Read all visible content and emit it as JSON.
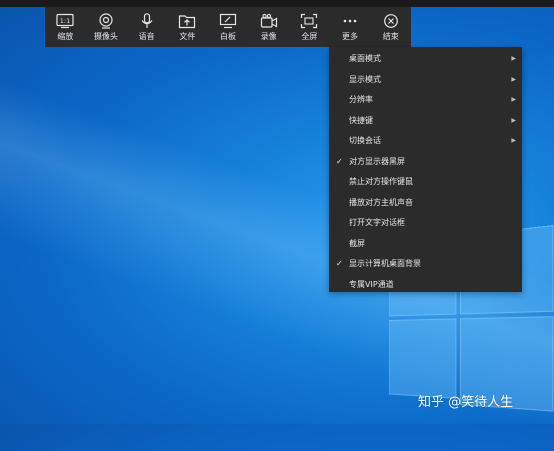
{
  "toolbar": {
    "items": [
      {
        "label": "缩放",
        "icon": "zoom-1to1-icon",
        "icon_text": "1:1"
      },
      {
        "label": "摄像头",
        "icon": "camera-icon"
      },
      {
        "label": "语音",
        "icon": "microphone-icon"
      },
      {
        "label": "文件",
        "icon": "file-upload-icon"
      },
      {
        "label": "白板",
        "icon": "whiteboard-icon"
      },
      {
        "label": "录像",
        "icon": "video-record-icon"
      },
      {
        "label": "全屏",
        "icon": "fullscreen-icon"
      },
      {
        "label": "更多",
        "icon": "more-icon"
      },
      {
        "label": "结束",
        "icon": "close-circle-icon"
      }
    ]
  },
  "menu": {
    "items": [
      {
        "label": "桌面模式",
        "submenu": true,
        "checked": false
      },
      {
        "label": "显示模式",
        "submenu": true,
        "checked": false
      },
      {
        "label": "分辨率",
        "submenu": true,
        "checked": false
      },
      {
        "label": "快捷键",
        "submenu": true,
        "checked": false
      },
      {
        "label": "切换会话",
        "submenu": true,
        "checked": false
      },
      {
        "label": "对方显示器黑屏",
        "submenu": false,
        "checked": true
      },
      {
        "label": "禁止对方操作键鼠",
        "submenu": false,
        "checked": false
      },
      {
        "label": "播放对方主机声音",
        "submenu": false,
        "checked": false
      },
      {
        "label": "打开文字对话框",
        "submenu": false,
        "checked": false
      },
      {
        "label": "截屏",
        "submenu": false,
        "checked": false
      },
      {
        "label": "显示计算机桌面背景",
        "submenu": false,
        "checked": true
      },
      {
        "label": "专属VIP通道",
        "submenu": false,
        "checked": false
      }
    ],
    "check_glyph": "✓",
    "arrow_glyph": "▶"
  },
  "watermark": {
    "text": "知乎 @笑待人生"
  },
  "colors": {
    "toolbar_bg": "#2b2b2b",
    "menu_bg": "#2b2b2b",
    "text": "#e8e8e8",
    "desktop": "#157fd8"
  }
}
